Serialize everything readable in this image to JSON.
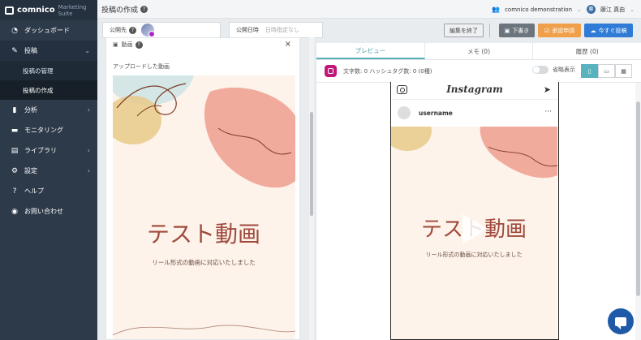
{
  "app": {
    "logo_text": "comnico",
    "logo_sub": "Marketing Suite",
    "page_title": "投稿の作成",
    "help": "?"
  },
  "user": {
    "workspace": "comnico demonstration",
    "name": "藤江 真由",
    "avatar_initial": "藤"
  },
  "sidebar": {
    "items": [
      {
        "label": "ダッシュボード",
        "icon": "gauge-icon",
        "glyph": "◔"
      },
      {
        "label": "投稿",
        "icon": "pencil-icon",
        "glyph": "✎",
        "chevron": "⌄"
      },
      {
        "label": "分析",
        "icon": "bar-chart-icon",
        "glyph": "▮",
        "chevron": "‹"
      },
      {
        "label": "モニタリング",
        "icon": "chat-icon",
        "glyph": "▬"
      },
      {
        "label": "ライブラリ",
        "icon": "book-icon",
        "glyph": "▤",
        "chevron": "‹"
      },
      {
        "label": "設定",
        "icon": "gear-icon",
        "glyph": "⚙",
        "chevron": "‹"
      },
      {
        "label": "ヘルプ",
        "icon": "question-icon",
        "glyph": "?"
      },
      {
        "label": "お問い合わせ",
        "icon": "support-icon",
        "glyph": "◉"
      }
    ],
    "sub_items": [
      {
        "label": "投稿の管理"
      },
      {
        "label": "投稿の作成"
      }
    ]
  },
  "toolbar": {
    "destination_label": "公開先",
    "schedule_label": "公開日時",
    "schedule_placeholder": "日時指定なし",
    "end_edit": "編集を終了",
    "draft": "下書き",
    "approve": "承認申請",
    "publish_now": "今すぐ投稿"
  },
  "left_panel": {
    "header": "動画",
    "close": "×",
    "upload_label": "アップロードした動画"
  },
  "video": {
    "title": "テスト動画",
    "subtitle": "リール形式の動画に対応いたしました"
  },
  "right_panel": {
    "tabs": [
      "プレビュー",
      "メモ (0)",
      "履歴 (0)"
    ],
    "counts": "文字数: 0 ハッシュタグ数: 0 (0種)",
    "omit_label": "省略表示"
  },
  "preview": {
    "brand": "Instagram",
    "username": "username",
    "more": "···",
    "send": "➤"
  },
  "colors": {
    "sidebar": "#2d3a4a",
    "accent": "#58b3bf",
    "approve": "#f0a04b",
    "publish": "#2f7bd6",
    "title": "#a0493c"
  }
}
